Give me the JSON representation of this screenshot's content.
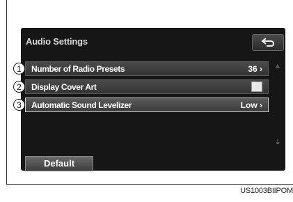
{
  "screen": {
    "title": "Audio Settings"
  },
  "settings": {
    "items": [
      {
        "callout": "1",
        "label": "Number of Radio Presets",
        "value": "36 ›"
      },
      {
        "callout": "2",
        "label": "Display Cover Art",
        "checked": false
      },
      {
        "callout": "3",
        "label": "Automatic Sound Levelizer",
        "value": "Low ›"
      }
    ]
  },
  "buttons": {
    "default_label": "Default",
    "back_icon": "back-arrow-icon"
  },
  "scroll": {
    "up_icon": "chevron-up-icon",
    "down_icon": "scroll-bottom-icon"
  },
  "caption": "US1003BIIPOM"
}
